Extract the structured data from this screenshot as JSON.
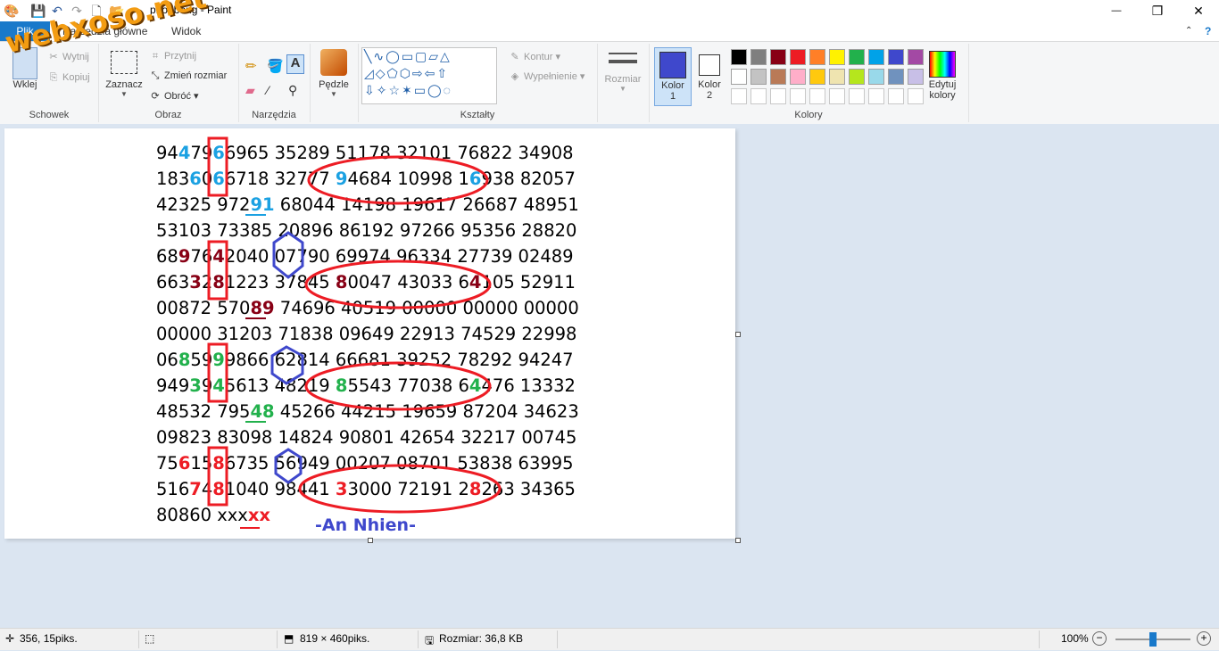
{
  "window": {
    "title": "phoi-bong - Paint",
    "minimize": "—",
    "maximize": "❐",
    "close": "✕"
  },
  "tabs": {
    "file": "Plik",
    "home": "Narzędzia główne",
    "view": "Widok"
  },
  "ribbon": {
    "clipboard": {
      "label": "Schowek",
      "paste": "Wklej",
      "cut": "Wytnij",
      "copy": "Kopiuj"
    },
    "image": {
      "label": "Obraz",
      "select": "Zaznacz",
      "crop": "Przytnij",
      "resize": "Zmień rozmiar",
      "rotate": "Obróć"
    },
    "tools": {
      "label": "Narzędzia"
    },
    "brushes": {
      "label": "Pędzle"
    },
    "shapes": {
      "label": "Kształty",
      "outline": "Kontur",
      "fill": "Wypełnienie"
    },
    "size": {
      "label": "Rozmiar"
    },
    "colors": {
      "label": "Kolory",
      "color1": "Kolor\n1",
      "color2": "Kolor\n2",
      "edit": "Edytuj\nkolory",
      "color1_value": "#3f48cc",
      "color2_value": "#ffffff",
      "palette_row1": [
        "#000000",
        "#7f7f7f",
        "#880015",
        "#ed1c24",
        "#ff7f27",
        "#fff200",
        "#22b14c",
        "#00a2e8",
        "#3f48cc",
        "#a349a4"
      ],
      "palette_row2": [
        "#ffffff",
        "#c3c3c3",
        "#b97a57",
        "#ffaec9",
        "#ffc90e",
        "#efe4b0",
        "#b5e61d",
        "#99d9ea",
        "#7092be",
        "#c8bfe7"
      ]
    }
  },
  "watermark": "webxoso.net",
  "drawing": {
    "lines": [
      [
        [
          "94",
          ""
        ],
        [
          "4",
          "#1ba1e2"
        ],
        [
          "79",
          ""
        ],
        [
          "6",
          "#1ba1e2"
        ],
        [
          "6965 35289 51178 32101 76822 34908",
          ""
        ]
      ],
      [
        [
          "183",
          ""
        ],
        [
          "6",
          "#1ba1e2"
        ],
        [
          "0",
          ""
        ],
        [
          "6",
          "#1ba1e2"
        ],
        [
          "6718 32777 ",
          ""
        ],
        [
          "9",
          "#1ba1e2"
        ],
        [
          "4684 10998 1",
          ""
        ],
        [
          "6",
          "#1ba1e2"
        ],
        [
          "938 82057",
          ""
        ]
      ],
      [
        [
          "42325 972",
          ""
        ],
        [
          "91",
          "#1ba1e2"
        ],
        [
          " 68044 14198 19617 26687 48951",
          ""
        ]
      ],
      [
        [
          "53103 73385 20896 86192 97266 95356 28820",
          ""
        ]
      ],
      [
        [
          "68",
          ""
        ],
        [
          "9",
          "#880015"
        ],
        [
          "76",
          ""
        ],
        [
          "4",
          "#880015"
        ],
        [
          "2040 07790 69974 96334 27739 02489",
          ""
        ]
      ],
      [
        [
          "663",
          ""
        ],
        [
          "3",
          "#880015"
        ],
        [
          "2",
          ""
        ],
        [
          "8",
          "#880015"
        ],
        [
          "1223 37845 ",
          ""
        ],
        [
          "8",
          "#880015"
        ],
        [
          "0047 43033 6",
          ""
        ],
        [
          "4",
          "#880015"
        ],
        [
          "105 52911",
          ""
        ]
      ],
      [
        [
          "00872 570",
          ""
        ],
        [
          "89",
          "#880015"
        ],
        [
          " 74696 40519 00000 00000 00000",
          ""
        ]
      ],
      [
        [
          "00000 31203 71838 09649 22913 74529 22998",
          ""
        ]
      ],
      [
        [
          "06",
          ""
        ],
        [
          "8",
          "#22b14c"
        ],
        [
          "59",
          ""
        ],
        [
          "9",
          "#22b14c"
        ],
        [
          "9866 62814 66681 39252 78292 94247",
          ""
        ]
      ],
      [
        [
          "949",
          ""
        ],
        [
          "3",
          "#22b14c"
        ],
        [
          "9",
          ""
        ],
        [
          "4",
          "#22b14c"
        ],
        [
          "5613 48219 ",
          ""
        ],
        [
          "8",
          "#22b14c"
        ],
        [
          "5543 77038 6",
          ""
        ],
        [
          "4",
          "#22b14c"
        ],
        [
          "476 13332",
          ""
        ]
      ],
      [
        [
          "48532 795",
          ""
        ],
        [
          "48",
          "#22b14c"
        ],
        [
          " 45266 44215 19659 87204 34623",
          ""
        ]
      ],
      [
        [
          "09823 83098 14824 90801 42654 32217 00745",
          ""
        ]
      ],
      [
        [
          "75",
          ""
        ],
        [
          "6",
          "#ed1c24"
        ],
        [
          "15",
          ""
        ],
        [
          "8",
          "#ed1c24"
        ],
        [
          "6735 56949 00207 08701 53838 63995",
          ""
        ]
      ],
      [
        [
          "516",
          ""
        ],
        [
          "7",
          "#ed1c24"
        ],
        [
          "4",
          ""
        ],
        [
          "8",
          "#ed1c24"
        ],
        [
          "1040 98441 ",
          ""
        ],
        [
          "3",
          "#ed1c24"
        ],
        [
          "3000 72191 2",
          ""
        ],
        [
          "8",
          "#ed1c24"
        ],
        [
          "263 34365",
          ""
        ]
      ],
      [
        [
          "80860 xxx",
          ""
        ],
        [
          "xx",
          "#ed1c24"
        ]
      ]
    ],
    "signature": "-An Nhien-"
  },
  "status": {
    "cursor": "356, 15piks.",
    "image_size": "819 × 460piks.",
    "file_size": "Rozmiar: 36,8 KB",
    "zoom": "100%",
    "zoom_level": 0.5
  }
}
